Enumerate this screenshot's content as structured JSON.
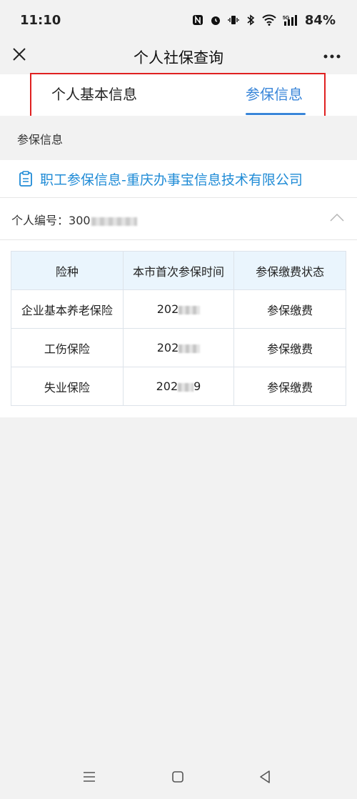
{
  "status_bar": {
    "time": "11:10",
    "battery": "84%"
  },
  "header": {
    "title": "个人社保查询",
    "close_icon": "close-icon",
    "more_icon": "more-icon"
  },
  "tabs": [
    {
      "label": "个人基本信息",
      "active": false
    },
    {
      "label": "参保信息",
      "active": true
    }
  ],
  "accent_color": "#3a86d9",
  "highlight_color": "#e02020",
  "section": {
    "label": "参保信息"
  },
  "company": {
    "label": "职工参保信息-重庆办事宝信息技术有限公司",
    "icon": "document-icon"
  },
  "person": {
    "id_label": "个人编号：",
    "id_prefix": "300"
  },
  "table": {
    "headers": [
      "险种",
      "本市首次参保时间",
      "参保缴费状态"
    ],
    "rows": [
      {
        "type": "企业基本养老保险",
        "date_prefix": "202",
        "status": "参保缴费"
      },
      {
        "type": "工伤保险",
        "date_prefix": "202",
        "status": "参保缴费"
      },
      {
        "type": "失业保险",
        "date_prefix": "202",
        "date_suffix": "9",
        "status": "参保缴费"
      }
    ]
  }
}
